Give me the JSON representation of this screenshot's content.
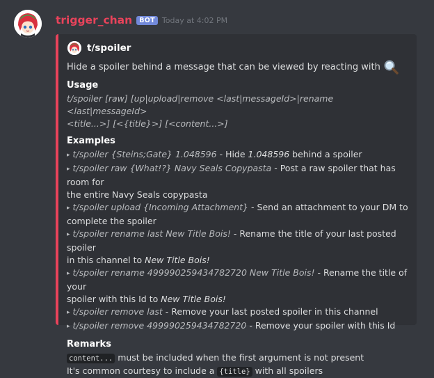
{
  "message": {
    "username": "trigger_chan",
    "bot_tag": "BOT",
    "timestamp": "Today at 4:02 PM"
  },
  "colors": {
    "accent": "#e9435b",
    "bot_tag": "#7289da",
    "background": "#36393f",
    "embed_background": "#2f3136"
  },
  "embed": {
    "author": "t/spoiler",
    "description": "Hide a spoiler behind a message that can be viewed by reacting with",
    "description_icon": "magnifying-glass-icon",
    "usage": {
      "title": "Usage",
      "line1": "t/spoiler [raw] [up|upload|remove <last|messageId>|rename <last|messageId>",
      "line2": "<title...>] [<{title}>] [<content...>]"
    },
    "examples": {
      "title": "Examples",
      "items": [
        {
          "cmd": "t/spoiler {Steins;Gate} 1.048596",
          "sep": " - ",
          "desc": "Hide ",
          "em": "1.048596",
          "desc2": " behind a spoiler"
        },
        {
          "cmd": "t/spoiler raw {What!?} Navy Seals Copypasta",
          "sep": " - ",
          "desc": "Post a raw spoiler that has room for",
          "desc_line2": "the entire Navy Seals copypasta"
        },
        {
          "cmd": "t/spoiler upload {Incoming Attachment}",
          "sep": " - ",
          "desc": "Send an attachment to your DM to",
          "desc_line2": "complete the spoiler"
        },
        {
          "cmd": "t/spoiler rename last New Title Bois!",
          "sep": " - ",
          "desc": "Rename the title of your last posted spoiler",
          "desc_line2": "in this channel to ",
          "em": "New Title Bois!"
        },
        {
          "cmd": "t/spoiler rename 499990259434782720 New Title Bois!",
          "sep": " - ",
          "desc": "Rename the title of your",
          "desc_line2": "spoiler with this Id to ",
          "em": "New Title Bois!"
        },
        {
          "cmd": "t/spoiler remove last",
          "sep": " - ",
          "desc": "Remove your last posted spoiler in this channel"
        },
        {
          "cmd": "t/spoiler remove 499990259434782720",
          "sep": " - ",
          "desc": "Remove your spoiler with this Id"
        }
      ]
    },
    "remarks": {
      "title": "Remarks",
      "line1_code": "content...",
      "line1_text": " must be included when the first argument is not present",
      "line2_text_a": "It's common courtesy to include a ",
      "line2_code": "{title}",
      "line2_text_b": " with all spoilers"
    }
  }
}
